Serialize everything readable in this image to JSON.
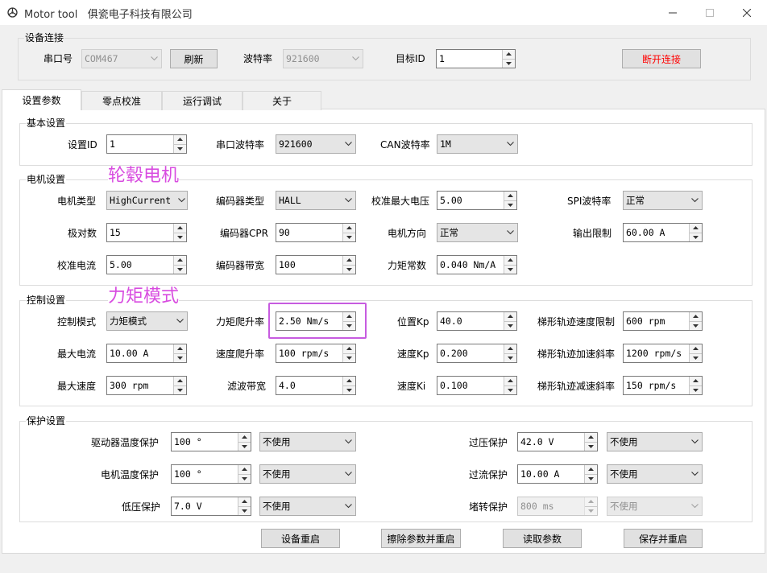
{
  "window": {
    "title": "Motor tool",
    "company": "俱瓷电子科技有限公司",
    "icon": "motor-app-icon",
    "controls": [
      "minimize-icon",
      "maximize-icon",
      "close-icon"
    ]
  },
  "connection": {
    "group_label": "设备连接",
    "port_label": "串口号",
    "port_value": "COM467",
    "refresh_label": "刷新",
    "baud_label": "波特率",
    "baud_value": "921600",
    "target_id_label": "目标ID",
    "target_id_value": "1",
    "disconnect_label": "断开连接",
    "disconnect_color": "#ff0000"
  },
  "tabs": [
    {
      "label": "设置参数",
      "active": true
    },
    {
      "label": "零点校准",
      "active": false
    },
    {
      "label": "运行调试",
      "active": false
    },
    {
      "label": "关于",
      "active": false
    }
  ],
  "basic": {
    "group_label": "基本设置",
    "id_label": "设置ID",
    "id_value": "1",
    "uart_baud_label": "串口波特率",
    "uart_baud_value": "921600",
    "can_baud_label": "CAN波特率",
    "can_baud_value": "1M"
  },
  "motor": {
    "group_label": "电机设置",
    "annotation": "轮毂电机",
    "annotation_color": "#d84ce0",
    "motor_type_label": "电机类型",
    "motor_type_value": "HighCurrent",
    "encoder_type_label": "编码器类型",
    "encoder_type_value": "HALL",
    "cal_max_voltage_label": "校准最大电压",
    "cal_max_voltage_value": "5.00",
    "spi_baud_label": "SPI波特率",
    "spi_baud_value": "正常",
    "pole_pairs_label": "极对数",
    "pole_pairs_value": "15",
    "encoder_cpr_label": "编码器CPR",
    "encoder_cpr_value": "90",
    "motor_dir_label": "电机方向",
    "motor_dir_value": "正常",
    "output_limit_label": "输出限制",
    "output_limit_value": "60.00 A",
    "cal_current_label": "校准电流",
    "cal_current_value": "5.00",
    "encoder_bw_label": "编码器带宽",
    "encoder_bw_value": "100",
    "torque_const_label": "力矩常数",
    "torque_const_value": "0.040 Nm/A"
  },
  "control": {
    "group_label": "控制设置",
    "annotation": "力矩模式",
    "annotation_color": "#d84ce0",
    "mode_label": "控制模式",
    "mode_value": "力矩模式",
    "torque_ramp_label": "力矩爬升率",
    "torque_ramp_value": "2.50 Nm/s",
    "pos_kp_label": "位置Kp",
    "pos_kp_value": "40.0",
    "traj_vel_label": "梯形轨迹速度限制",
    "traj_vel_value": "600 rpm",
    "max_current_label": "最大电流",
    "max_current_value": "10.00 A",
    "vel_ramp_label": "速度爬升率",
    "vel_ramp_value": "100 rpm/s",
    "vel_kp_label": "速度Kp",
    "vel_kp_value": "0.200",
    "traj_accel_label": "梯形轨迹加速斜率",
    "traj_accel_value": "1200 rpm/s",
    "max_speed_label": "最大速度",
    "max_speed_value": "300 rpm",
    "filter_bw_label": "滤波带宽",
    "filter_bw_value": "4.0",
    "vel_ki_label": "速度Ki",
    "vel_ki_value": "0.100",
    "traj_decel_label": "梯形轨迹减速斜率",
    "traj_decel_value": "150 rpm/s"
  },
  "protect": {
    "group_label": "保护设置",
    "driver_temp_label": "驱动器温度保护",
    "driver_temp_value": "100 °",
    "driver_temp_mode": "不使用",
    "motor_temp_label": "电机温度保护",
    "motor_temp_value": "100 °",
    "motor_temp_mode": "不使用",
    "undervolt_label": "低压保护",
    "undervolt_value": "7.0 V",
    "undervolt_mode": "不使用",
    "overvolt_label": "过压保护",
    "overvolt_value": "42.0 V",
    "overvolt_mode": "不使用",
    "overcurrent_label": "过流保护",
    "overcurrent_value": "10.00 A",
    "overcurrent_mode": "不使用",
    "stall_label": "堵转保护",
    "stall_value": "800 ms",
    "stall_mode": "不使用"
  },
  "actions": {
    "restart_label": "设备重启",
    "erase_restart_label": "擦除参数并重启",
    "read_label": "读取参数",
    "save_restart_label": "保存并重启"
  }
}
